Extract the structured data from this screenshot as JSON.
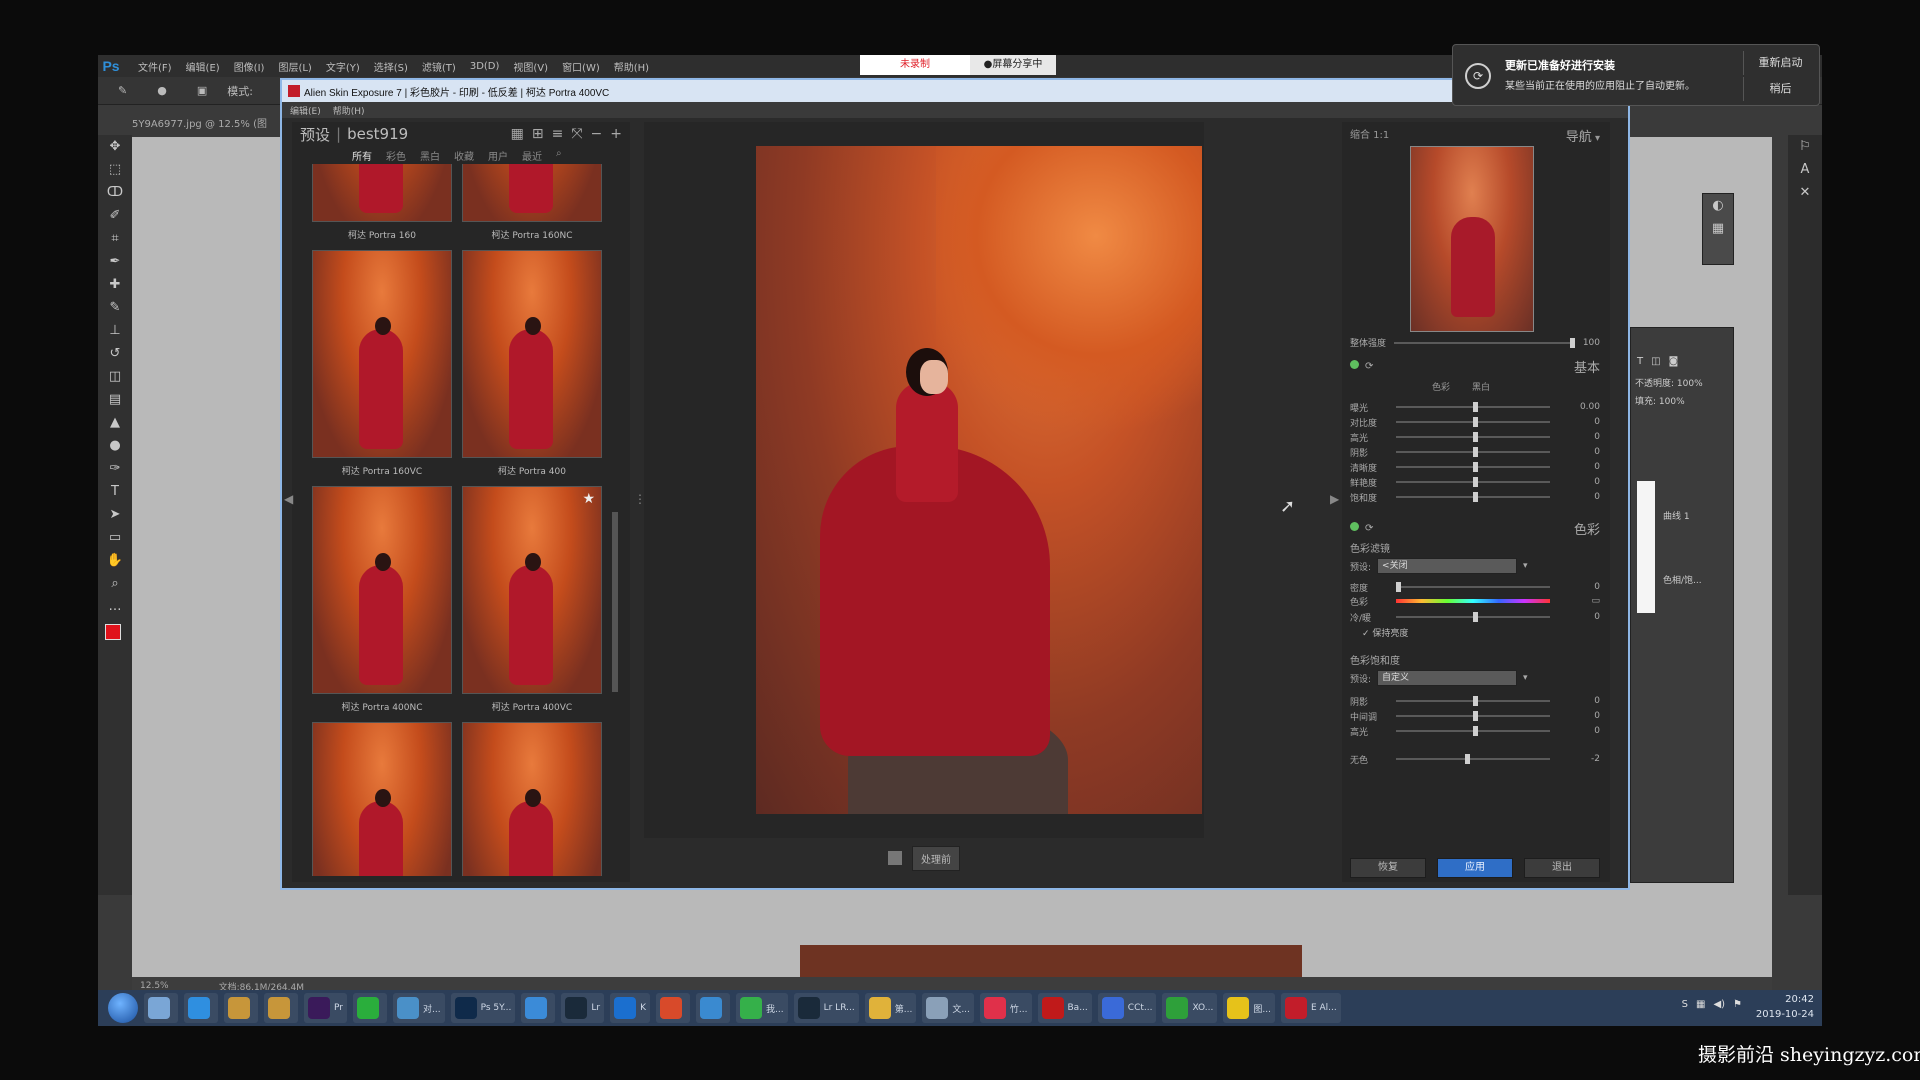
{
  "photoshop": {
    "logo": "Ps",
    "menus": [
      "文件(F)",
      "编辑(E)",
      "图像(I)",
      "图层(L)",
      "文字(Y)",
      "选择(S)",
      "滤镜(T)",
      "3D(D)",
      "视图(V)",
      "窗口(W)",
      "帮助(H)"
    ],
    "options_mode": "模式:",
    "doc_tab": "5Y9A6977.jpg @ 12.5% (图",
    "zoom": "12.5%",
    "doc_size": "文档:86.1M/264.4M",
    "layers": {
      "opacity_label": "不透明度:",
      "opacity_value": "100%",
      "fill_label": "填充:",
      "fill_value": "100%",
      "layer1": "曲线 1",
      "layer2": "色相/饱..."
    }
  },
  "recording": {
    "status": "未录制",
    "share": "●屏幕分享中"
  },
  "exposure": {
    "title": "Alien Skin Exposure 7 | 彩色胶片 - 印刷 - 低反差 | 柯达 Portra 400VC",
    "menus": [
      "编辑(E)",
      "帮助(H)"
    ],
    "presets": {
      "header": "预设",
      "folder": "best919",
      "filters": [
        "所有",
        "彩色",
        "黑白",
        "收藏",
        "用户",
        "最近"
      ],
      "items": [
        {
          "label": "柯达 Portra 160"
        },
        {
          "label": "柯达 Portra 160NC"
        },
        {
          "label": "柯达 Portra 160VC"
        },
        {
          "label": "柯达 Portra 400"
        },
        {
          "label": "柯达 Portra 400NC"
        },
        {
          "label": "柯达 Portra 400VC"
        },
        {
          "label": ""
        },
        {
          "label": ""
        }
      ]
    },
    "preview": {
      "before_button": "处理前"
    },
    "navigator": {
      "zoom_label": "缩合  1:1",
      "title": "导航"
    },
    "overall": {
      "label": "整体强度",
      "value": "100",
      "level": 1.0
    },
    "basic": {
      "title": "基本",
      "tabs": [
        "色彩",
        "黑白"
      ],
      "rows": [
        {
          "label": "曝光",
          "value": "0.00"
        },
        {
          "label": "对比度",
          "value": "0"
        },
        {
          "label": "高光",
          "value": "0"
        },
        {
          "label": "阴影",
          "value": "0"
        },
        {
          "label": "清晰度",
          "value": "0"
        },
        {
          "label": "鲜艳度",
          "value": "0"
        },
        {
          "label": "饱和度",
          "value": "0"
        }
      ]
    },
    "color": {
      "title": "色彩",
      "filter_group": "色彩滤镜",
      "preset_label": "预设:",
      "filter_preset": "<关闭",
      "density_label": "密度",
      "density_value": "0",
      "hue_label": "色彩",
      "shade_label": "冷/暖",
      "shade_value": "0",
      "preserve_label": "保持亮度",
      "sat_group": "色彩饱和度",
      "sat_preset": "自定义",
      "sat_rows": [
        {
          "label": "阴影",
          "value": "0"
        },
        {
          "label": "中间调",
          "value": "0"
        },
        {
          "label": "高光",
          "value": "0"
        }
      ],
      "last_label": "无色",
      "last_value": "-2"
    },
    "buttons": {
      "reset": "恢复",
      "apply": "应用",
      "exit": "退出"
    }
  },
  "notification": {
    "title": "更新已准备好进行安装",
    "body": "某些当前正在使用的应用阻止了自动更新。",
    "restart": "重新启动",
    "later": "稍后"
  },
  "taskbar": {
    "apps": [
      {
        "icon": "file-icon",
        "label": "",
        "color": "#7aa6d6"
      },
      {
        "icon": "browser-icon",
        "label": "",
        "color": "#2f8fe0"
      },
      {
        "icon": "tool-icon",
        "label": "",
        "color": "#c7963a"
      },
      {
        "icon": "tool2-icon",
        "label": "",
        "color": "#c7963a"
      },
      {
        "icon": "premiere-icon",
        "label": "Pr",
        "color": "#3a1a5a"
      },
      {
        "icon": "wechat-icon",
        "label": "",
        "color": "#2aae3c"
      },
      {
        "icon": "app-icon",
        "label": "对...",
        "color": "#4a90c8"
      },
      {
        "icon": "photoshop-icon",
        "label": "Ps 5Y...",
        "color": "#0f2a4a"
      },
      {
        "icon": "ie-icon",
        "label": "",
        "color": "#3b8bd8"
      },
      {
        "icon": "lightroom-icon",
        "label": "Lr",
        "color": "#1a2a3a"
      },
      {
        "icon": "k-icon",
        "label": "K",
        "color": "#1b6fcf"
      },
      {
        "icon": "box-icon",
        "label": "",
        "color": "#d84a2a"
      },
      {
        "icon": "photos-icon",
        "label": "",
        "color": "#3a8ad0"
      },
      {
        "icon": "green-icon",
        "label": "我...",
        "color": "#35b04a"
      },
      {
        "icon": "lightroom2-icon",
        "label": "Lr LR...",
        "color": "#1a2a3a"
      },
      {
        "icon": "folder-icon",
        "label": "第...",
        "color": "#e0b23a"
      },
      {
        "icon": "mail-icon",
        "label": "文...",
        "color": "#8aa0b8"
      },
      {
        "icon": "heart-icon",
        "label": "竹...",
        "color": "#e0304a"
      },
      {
        "icon": "record-icon",
        "label": "Ba...",
        "color": "#c01a1a"
      },
      {
        "icon": "cc-icon",
        "label": "CCt...",
        "color": "#3a6ad8"
      },
      {
        "icon": "xo-icon",
        "label": "XO...",
        "color": "#2ea03a"
      },
      {
        "icon": "player-icon",
        "label": "图...",
        "color": "#e6c21a"
      },
      {
        "icon": "exposure-icon",
        "label": "E Al...",
        "color": "#c21d2a"
      }
    ],
    "time": "20:42",
    "date": "2019-10-24"
  },
  "watermark": "摄影前沿 sheyingzyz.com"
}
